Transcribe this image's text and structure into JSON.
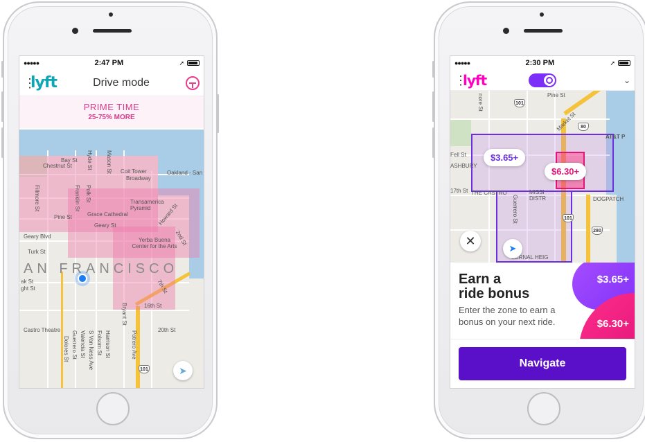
{
  "left_phone": {
    "status": {
      "signal": "●●●●●",
      "time": "2:47 PM"
    },
    "header": {
      "logo": "lyft",
      "title": "Drive mode"
    },
    "prime": {
      "title": "PRIME TIME",
      "subtitle": "25-75% MORE"
    },
    "map": {
      "city_label": "AN FRANCISCO",
      "labels": [
        "Bay St",
        "Chestnut St",
        "Coit Tower",
        "Broadway",
        "Oakland - San",
        "Fillmore St",
        "Franklin St",
        "Polk St",
        "Hyde St",
        "Mason St",
        "Transamerica Pyramid",
        "Grace Cathedral",
        "Pine St",
        "Geary St",
        "Geary Blvd",
        "Turk St",
        "Yerba Buena Center for the Arts",
        "Howard St",
        "2nd St",
        "7th St",
        "16th St",
        "20th St",
        "Castro Theatre",
        "Guerrero St",
        "Dolores St",
        "Valencia St",
        "S Van Ness Ave",
        "Folsom St",
        "Harrison St",
        "Bryant St",
        "Potrero Ave",
        "ght St",
        "ak St"
      ],
      "shield": "101"
    }
  },
  "right_phone": {
    "status": {
      "signal": "●●●●●",
      "time": "2:30 PM"
    },
    "header": {
      "logo": "lyft"
    },
    "map": {
      "labels": [
        "Pine St",
        "AT&T P",
        "Fell St",
        "ASHBURY",
        "17th St",
        "THE CASTRO",
        "MISSI DISTR",
        "DOGPATCH",
        "Guerrero St",
        "BERNAL HEIG",
        "nore St",
        "Market St"
      ],
      "shields": [
        "101",
        "80",
        "101",
        "280"
      ]
    },
    "bubbles": {
      "low": "$3.65+",
      "high": "$6.30+"
    },
    "bonus": {
      "title_line1": "Earn a",
      "title_line2": "ride bonus",
      "description": "Enter the zone to earn a bonus on your next ride.",
      "amount_low": "$3.65+",
      "amount_high": "$6.30+"
    },
    "navigate_label": "Navigate"
  },
  "colors": {
    "lyft_teal": "#0ea5b5",
    "lyft_pink": "#ff00bf",
    "prime_pink": "#d63a8a",
    "zone_purple": "#6b2ee0",
    "zone_magenta": "#e0167a",
    "navigate_purple": "#5a10c9"
  }
}
